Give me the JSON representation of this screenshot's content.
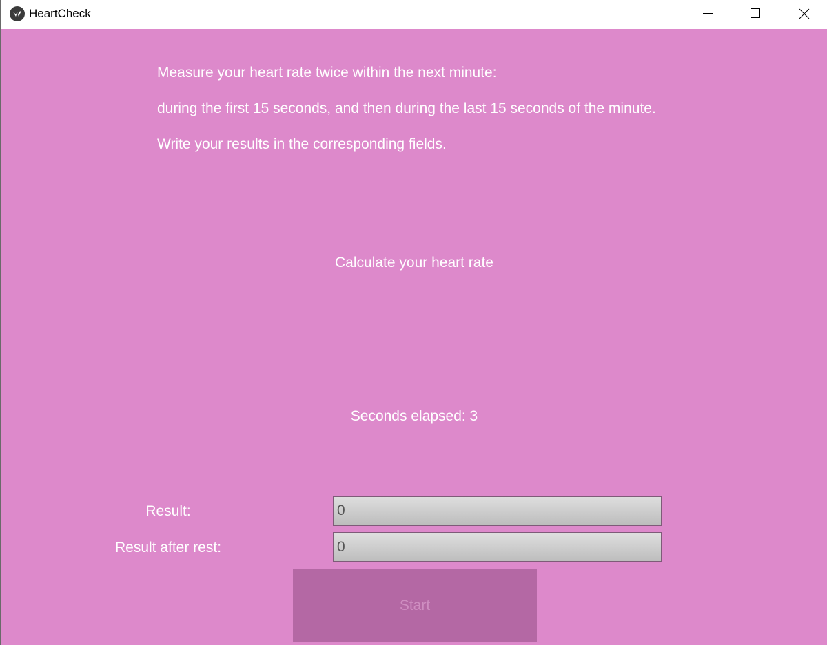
{
  "window": {
    "title": "HeartCheck",
    "app_icon": "kivy-logo-icon",
    "controls": [
      "minimize-icon",
      "maximize-icon",
      "close-icon"
    ]
  },
  "colors": {
    "background": "#dd89cb",
    "text": "#ffffff",
    "button_disabled_bg": "#b468a4",
    "button_disabled_text": "#cf8ec1",
    "field_border": "#7e5b78"
  },
  "instructions": {
    "line1": "Measure your heart rate twice within the next minute:",
    "line2": "during the first 15 seconds, and then during the last 15 seconds of the minute.",
    "line3": "Write your results in the corresponding fields."
  },
  "calculate_label": "Calculate your heart rate",
  "timer": {
    "text": "Seconds elapsed: 3"
  },
  "fields": {
    "result_label": "Result:",
    "result_value": "0",
    "rest_label": "Result after rest:",
    "rest_value": "0"
  },
  "start_button": {
    "label": "Start",
    "disabled": true
  }
}
